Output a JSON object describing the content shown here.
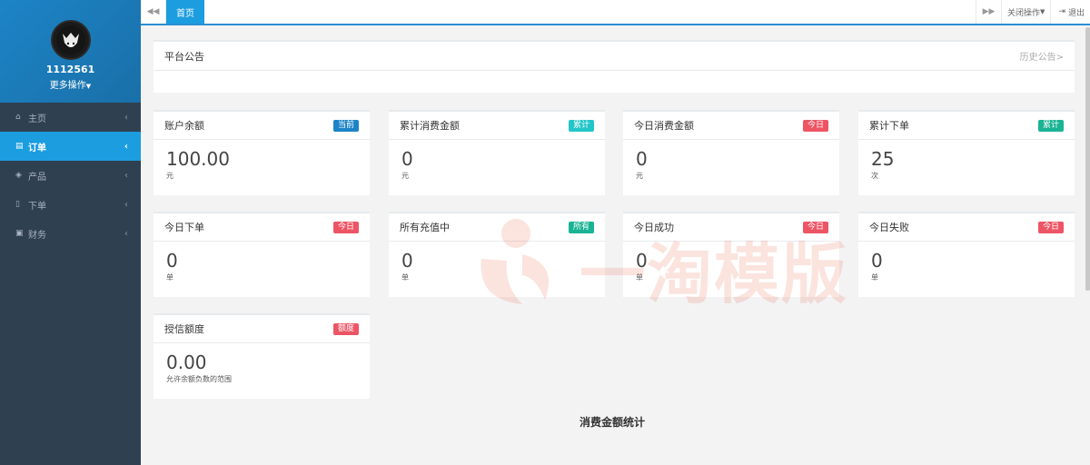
{
  "sidebar": {
    "profile": {
      "user_id": "1112561",
      "more_ops": "更多操作"
    },
    "items": [
      {
        "icon": "home-icon",
        "label": "主页",
        "active": false
      },
      {
        "icon": "document-icon",
        "label": "订单",
        "active": true
      },
      {
        "icon": "cube-icon",
        "label": "产品",
        "active": false
      },
      {
        "icon": "file-icon",
        "label": "下单",
        "active": false
      },
      {
        "icon": "money-icon",
        "label": "财务",
        "active": false
      }
    ]
  },
  "topbar": {
    "tab_home": "首页",
    "close_ops": "关闭操作",
    "logout": "退出"
  },
  "notice": {
    "title": "平台公告",
    "history_link": "历史公告>"
  },
  "cards": [
    {
      "title": "账户余额",
      "badge": "当前",
      "badge_color": "#1c84c6",
      "value": "100.00",
      "unit": "元"
    },
    {
      "title": "累计消费金额",
      "badge": "累计",
      "badge_color": "#23c6c8",
      "value": "0",
      "unit": "元"
    },
    {
      "title": "今日消费金额",
      "badge": "今日",
      "badge_color": "#ed5565",
      "value": "0",
      "unit": "元"
    },
    {
      "title": "累计下单",
      "badge": "累计",
      "badge_color": "#1ab394",
      "value": "25",
      "unit": "次"
    },
    {
      "title": "今日下单",
      "badge": "今日",
      "badge_color": "#ed5565",
      "value": "0",
      "unit": "单"
    },
    {
      "title": "所有充值中",
      "badge": "所有",
      "badge_color": "#1ab394",
      "value": "0",
      "unit": "单"
    },
    {
      "title": "今日成功",
      "badge": "今日",
      "badge_color": "#ed5565",
      "value": "0",
      "unit": "单"
    },
    {
      "title": "今日失败",
      "badge": "今日",
      "badge_color": "#ed5565",
      "value": "0",
      "unit": "单"
    },
    {
      "title": "授信额度",
      "badge": "额度",
      "badge_color": "#ed5565",
      "value": "0.00",
      "unit": "允许余额负数的范围"
    }
  ],
  "stats_title": "消费金额统计",
  "watermark": "一淘模版",
  "colors": {
    "sidebar_bg": "#2f4050",
    "active_item": "#1c9de0",
    "accent": "#2c8fd2"
  }
}
